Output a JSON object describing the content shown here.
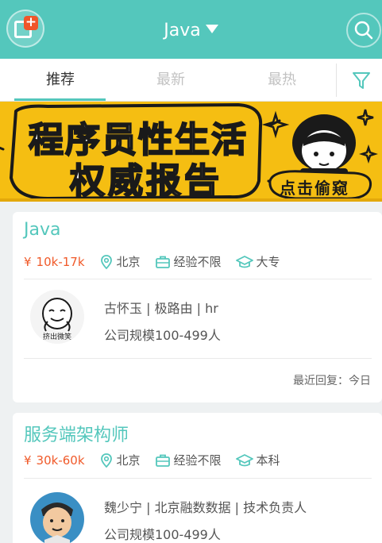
{
  "header": {
    "title": "Java",
    "back_icon": "app-return-icon",
    "search_icon": "search-icon",
    "accent_color": "#54c7bc"
  },
  "tabs": [
    {
      "label": "推荐",
      "active": true
    },
    {
      "label": "最新",
      "active": false
    },
    {
      "label": "最热",
      "active": false
    }
  ],
  "filter_icon": "filter-icon",
  "banner": {
    "line1": "程序员性生活",
    "line2": "权威报告",
    "tag": "点击偷窥"
  },
  "jobs": [
    {
      "title": "Java",
      "salary_symbol": "¥",
      "salary": "10k-17k",
      "city": "北京",
      "experience": "经验不限",
      "education": "大专",
      "recruiter": "古怀玉 | 极路由 | hr",
      "company_size": "公司规模100-499人",
      "avatar_caption": "挤出微笑",
      "last_reply": "最近回复：今日"
    },
    {
      "title": "服务端架构师",
      "salary_symbol": "¥",
      "salary": "30k-60k",
      "city": "北京",
      "experience": "经验不限",
      "education": "本科",
      "recruiter": "魏少宁 | 北京融数数据 | 技术负责人",
      "company_size": "公司规模100-499人"
    }
  ]
}
